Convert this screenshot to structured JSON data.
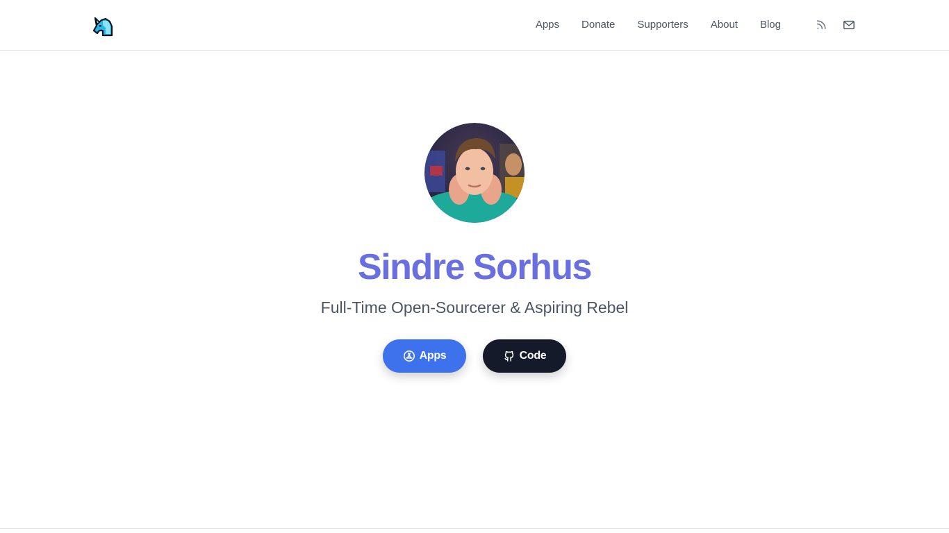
{
  "header": {
    "logo": {
      "icon": "unicorn-icon",
      "colors": [
        "#0b1220",
        "#22b8e8",
        "#8be3f5"
      ]
    },
    "nav": [
      {
        "label": "Apps"
      },
      {
        "label": "Donate"
      },
      {
        "label": "Supporters"
      },
      {
        "label": "About"
      },
      {
        "label": "Blog"
      }
    ],
    "icons": [
      {
        "icon": "rss-icon"
      },
      {
        "icon": "mail-icon"
      }
    ]
  },
  "hero": {
    "avatar": {
      "description_icon": "avatar"
    },
    "name": "Sindre Sorhus",
    "tagline": "Full-Time Open-Sourcerer & Aspiring Rebel",
    "buttons": [
      {
        "label": "Apps",
        "icon": "app-store-icon",
        "color": "#3d72ec"
      },
      {
        "label": "Code",
        "icon": "github-icon",
        "color": "#141a29"
      }
    ]
  },
  "colors": {
    "accent_name": "#6a6fe0",
    "nav_text": "#4b5563",
    "divider": "#e5e7eb"
  }
}
